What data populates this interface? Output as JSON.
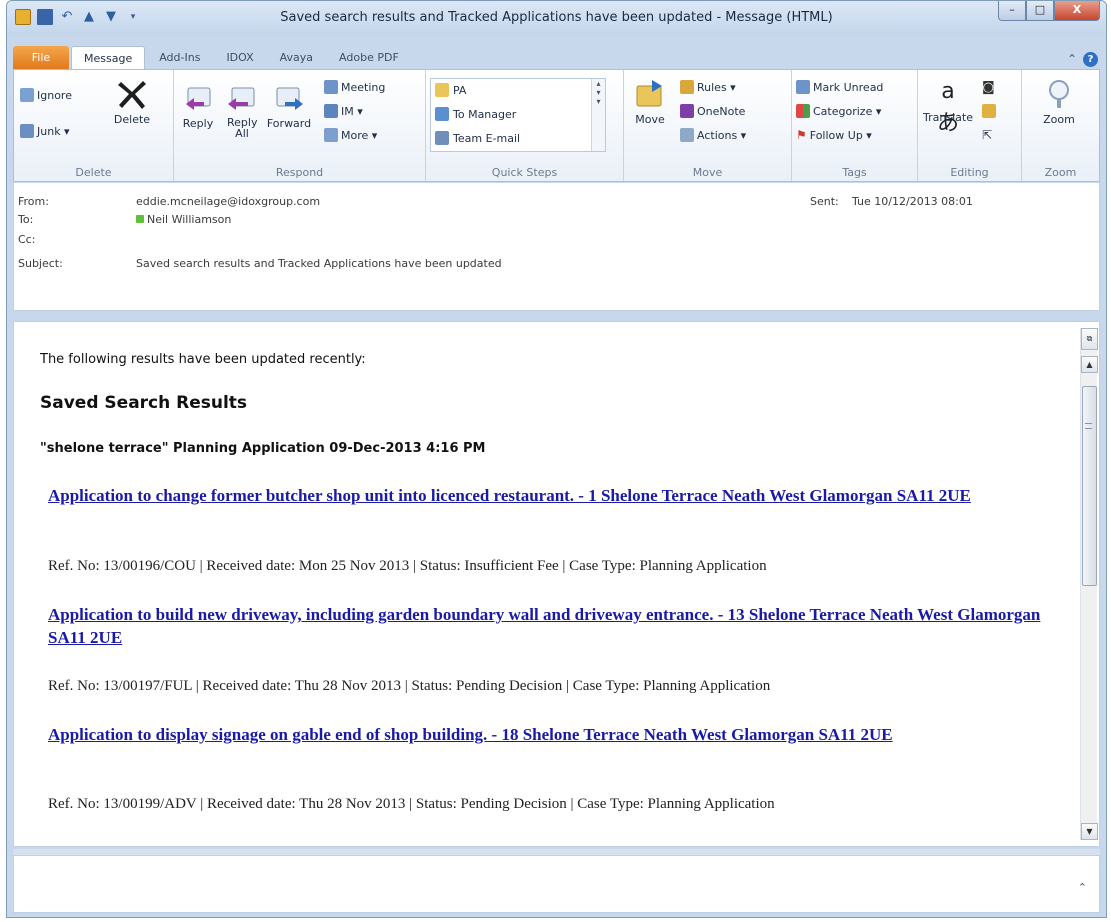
{
  "window": {
    "title": "Saved search results and Tracked Applications have been updated  -  Message (HTML)",
    "controls": {
      "minimize": "–",
      "maximize": "□",
      "close": "X"
    }
  },
  "ribbon_tabs": [
    "File",
    "Message",
    "Add-Ins",
    "IDOX",
    "Avaya",
    "Adobe PDF"
  ],
  "active_tab": "Message",
  "ribbon": {
    "delete_group": {
      "label": "Delete",
      "ignore": "Ignore",
      "junk": "Junk ▾",
      "delete": "Delete"
    },
    "respond_group": {
      "label": "Respond",
      "reply": "Reply",
      "reply_all": "Reply All",
      "forward": "Forward",
      "meeting": "Meeting",
      "im": "IM ▾",
      "more": "More ▾"
    },
    "quick_steps_group": {
      "label": "Quick Steps",
      "items": [
        "PA",
        "To Manager",
        "Team E-mail"
      ]
    },
    "move_group": {
      "label": "Move",
      "move": "Move",
      "rules": "Rules ▾",
      "onenote": "OneNote",
      "actions": "Actions ▾"
    },
    "tags_group": {
      "label": "Tags",
      "mark_unread": "Mark Unread",
      "categorize": "Categorize ▾",
      "follow_up": "Follow Up ▾"
    },
    "editing_group": {
      "label": "Editing",
      "translate": "Translate"
    },
    "zoom_group": {
      "label": "Zoom",
      "zoom": "Zoom"
    }
  },
  "header": {
    "from_label": "From:",
    "from_value": "eddie.mcneilage@idoxgroup.com",
    "to_label": "To:",
    "to_value": "Neil Williamson",
    "cc_label": "Cc:",
    "subject_label": "Subject:",
    "subject_value": "Saved search results and Tracked Applications have been updated",
    "sent_label": "Sent:",
    "sent_value": "Tue 10/12/2013 08:01"
  },
  "body": {
    "intro": "The following results have been updated recently:",
    "section_title": "Saved Search Results",
    "search_heading": "\"shelone terrace\" Planning Application 09-Dec-2013 4:16 PM",
    "applications": [
      {
        "title": "Application to change former butcher shop unit into licenced restaurant. - 1 Shelone Terrace Neath West Glamorgan SA11 2UE",
        "meta": "Ref. No: 13/00196/COU | Received date: Mon 25 Nov 2013 | Status: Insufficient Fee | Case Type: Planning Application"
      },
      {
        "title": "Application to build new driveway, including garden boundary wall and driveway entrance. - 13 Shelone Terrace Neath West Glamorgan SA11 2UE",
        "meta": "Ref. No: 13/00197/FUL | Received date: Thu 28 Nov 2013 | Status: Pending Decision | Case Type: Planning Application"
      },
      {
        "title": "Application to display signage on gable end of shop building. - 18 Shelone Terrace Neath West Glamorgan SA11 2UE",
        "meta": "Ref. No: 13/00199/ADV | Received date: Thu 28 Nov 2013 | Status: Pending Decision | Case Type: Planning Application"
      }
    ]
  },
  "colors": {
    "link": "#1a1aa6",
    "file_tab": "#e0781a",
    "presence": "#5fc039"
  }
}
